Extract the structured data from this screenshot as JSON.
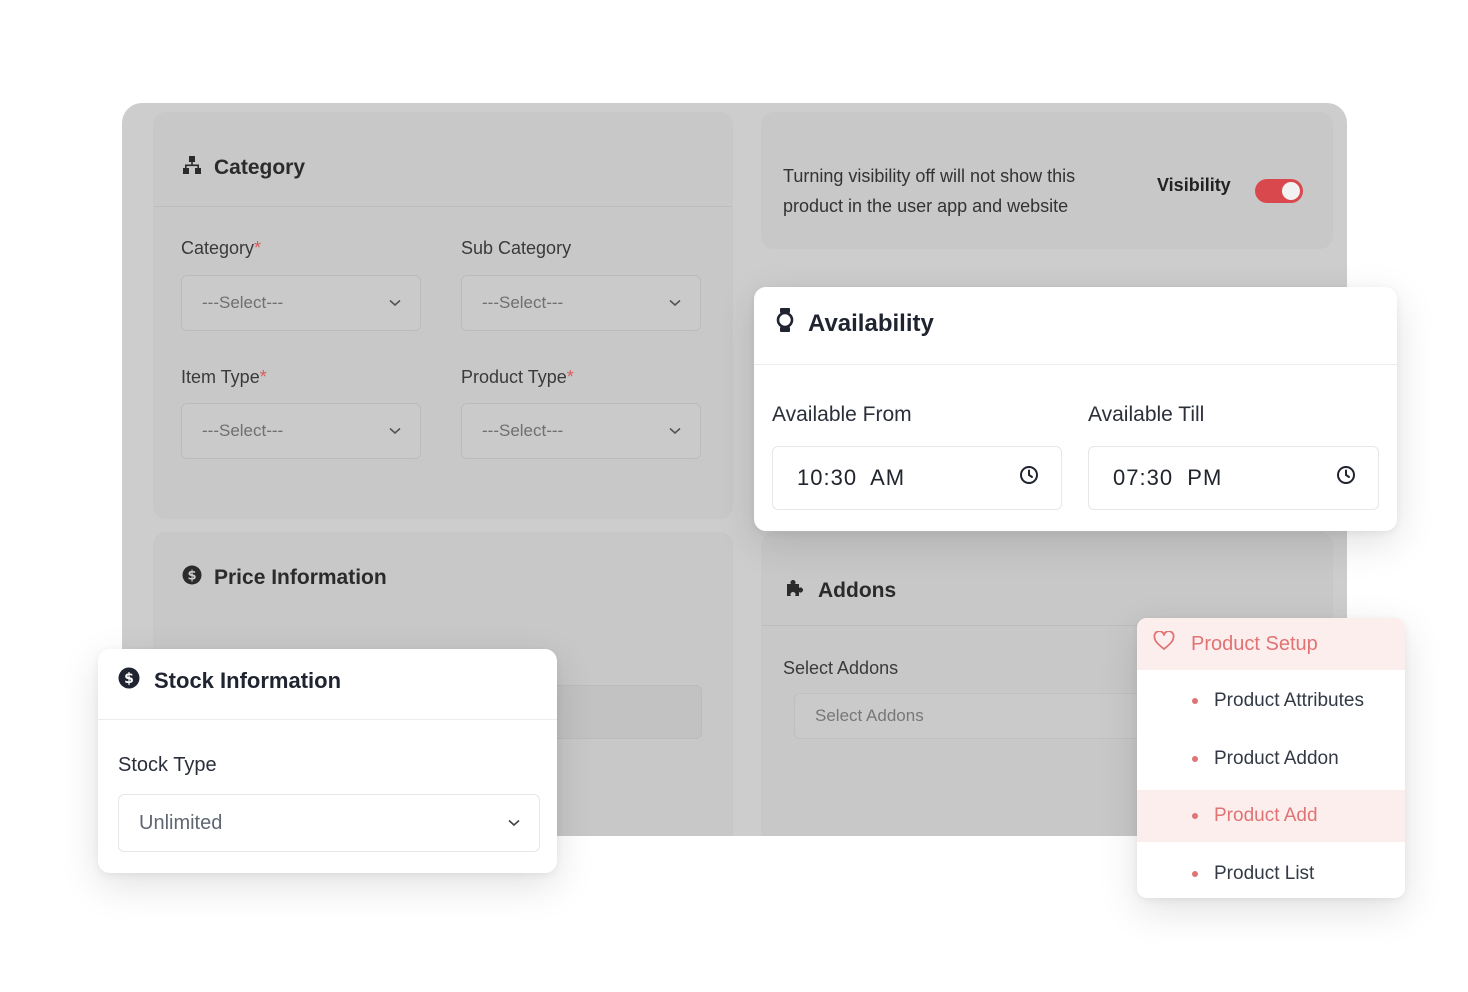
{
  "category": {
    "title": "Category",
    "category_label": "Category",
    "sub_category_label": "Sub Category",
    "item_type_label": "Item Type",
    "product_type_label": "Product Type",
    "required_mark": "*",
    "select_placeholder": "---Select---"
  },
  "visibility": {
    "note_line1": "Turning visibility off will not show this",
    "note_line2": "product in the user app and website",
    "label": "Visibility",
    "enabled": true
  },
  "price": {
    "title": "Price Information"
  },
  "availability": {
    "title": "Availability",
    "from_label": "Available From",
    "till_label": "Available Till",
    "from_value": "10:30  AM",
    "till_value": "07:30  PM"
  },
  "addons": {
    "title": "Addons",
    "select_label": "Select Addons",
    "select_placeholder": "Select Addons"
  },
  "stock": {
    "title": "Stock Information",
    "type_label": "Stock Type",
    "type_value": "Unlimited"
  },
  "menu": {
    "title": "Product Setup",
    "items": [
      {
        "label": "Product Attributes",
        "active": false
      },
      {
        "label": "Product Addon",
        "active": false
      },
      {
        "label": "Product Add",
        "active": true
      },
      {
        "label": "Product List",
        "active": false
      }
    ]
  },
  "colors": {
    "accent": "#e07373",
    "toggle": "#d9484d"
  },
  "icons": {
    "category": "sitemap-icon",
    "price": "dollar-circle-icon",
    "availability": "watch-icon",
    "addons": "puzzle-icon",
    "stock": "dollar-circle-icon",
    "menu": "heart-icon",
    "time": "clock-icon",
    "dropdown": "chevron-down-icon"
  }
}
